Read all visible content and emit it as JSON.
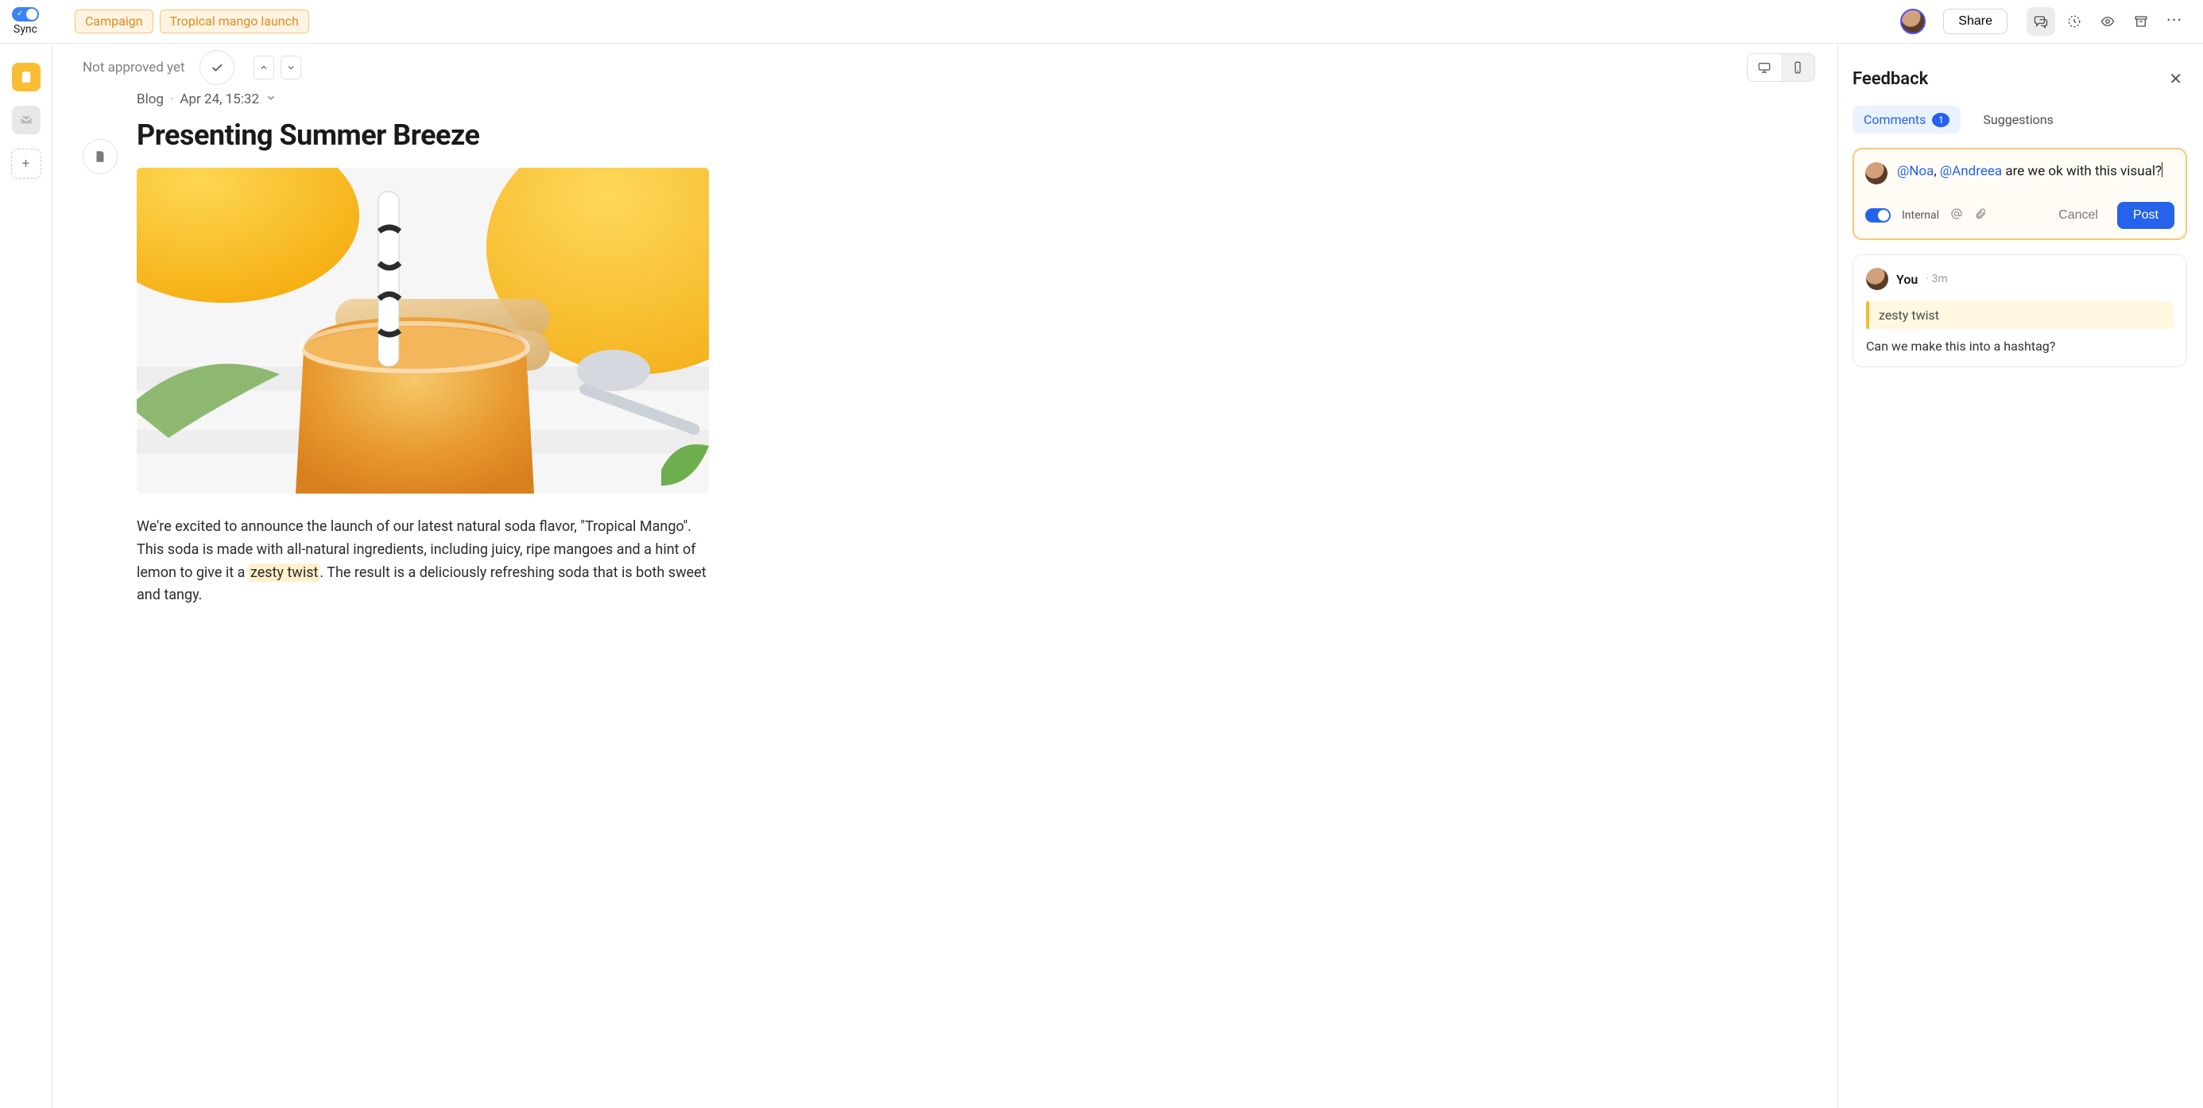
{
  "sync_label": "Sync",
  "tags": [
    "Campaign",
    "Tropical mango launch"
  ],
  "share_label": "Share",
  "approval_text": "Not approved yet",
  "post_meta": {
    "channel": "Blog",
    "time": "Apr 24, 15:32"
  },
  "title": "Presenting Summer Breeze",
  "body": {
    "pre": "We're excited to announce the launch of our latest natural soda flavor, \"Tropical Mango\". This soda is made with all-natural ingredients, including juicy, ripe mangoes and a hint of lemon to give it a ",
    "highlight": "zesty twist",
    "post": ". The result is a deliciously refreshing soda that is both sweet and tangy."
  },
  "panel": {
    "title": "Feedback",
    "tabs": {
      "comments": "Comments",
      "comments_count": "1",
      "suggestions": "Suggestions"
    }
  },
  "composer": {
    "mention1": "@Noa",
    "comma": ", ",
    "mention2": "@Andreea",
    "rest": " are we ok with this visual?",
    "internal_label": "Internal",
    "cancel": "Cancel",
    "post": "Post"
  },
  "comment": {
    "author": "You",
    "when": "3m",
    "quote": "zesty twist",
    "body": "Can we make this into a hashtag?"
  }
}
